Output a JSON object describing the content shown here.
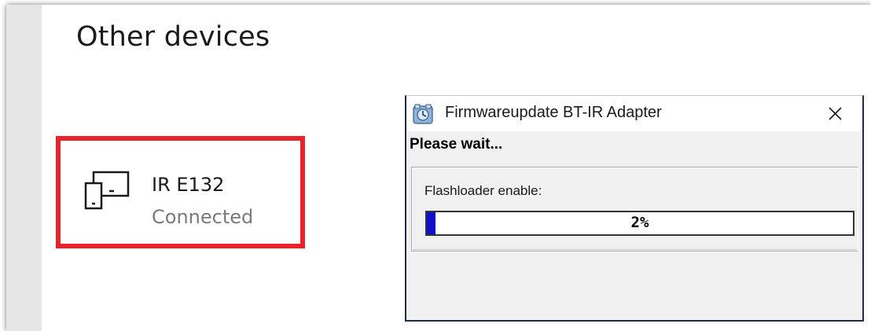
{
  "settings": {
    "section_title": "Other devices",
    "device": {
      "name": "IR E132",
      "status": "Connected",
      "icon": "devices-icon"
    },
    "highlight_color": "#e8232b"
  },
  "dialog": {
    "title": "Firmwareupdate BT-IR Adapter",
    "app_icon": "firmware-update-app-icon",
    "close_icon": "close-icon",
    "message": "Please wait...",
    "task_label": "Flashloader enable:",
    "progress": {
      "percent": 2,
      "text": "2%",
      "fill_color": "#1010cc"
    }
  }
}
